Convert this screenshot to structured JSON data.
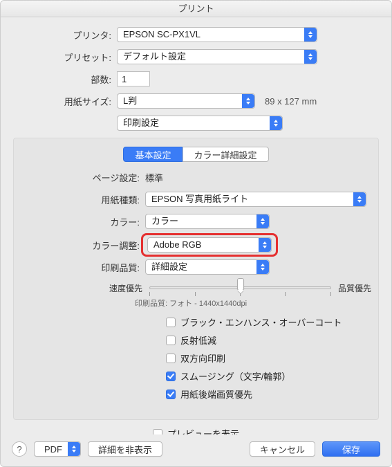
{
  "title": "プリント",
  "printer": {
    "label": "プリンタ:",
    "value": "EPSON SC-PX1VL"
  },
  "preset": {
    "label": "プリセット:",
    "value": "デフォルト設定"
  },
  "copies": {
    "label": "部数:",
    "value": "1"
  },
  "paperSize": {
    "label": "用紙サイズ:",
    "value": "L判",
    "dimensions": "89 x 127 mm"
  },
  "sectionSelect": {
    "value": "印刷設定"
  },
  "tabs": {
    "basic": "基本設定",
    "colorDetail": "カラー詳細設定"
  },
  "inner": {
    "pageSettings": {
      "label": "ページ設定:",
      "value": "標準"
    },
    "mediaType": {
      "label": "用紙種類:",
      "value": "EPSON 写真用紙ライト"
    },
    "color": {
      "label": "カラー:",
      "value": "カラー"
    },
    "colorAdjust": {
      "label": "カラー調整:",
      "value": "Adobe RGB"
    },
    "printQuality": {
      "label": "印刷品質:",
      "value": "詳細設定"
    },
    "slider": {
      "left": "速度優先",
      "right": "品質優先",
      "position_pct": 50,
      "ticks": 5
    },
    "qualityInfo": {
      "label": "印刷品質:",
      "value": "フォト - 1440x1440dpi"
    }
  },
  "checks": [
    {
      "label": "ブラック・エンハンス・オーバーコート",
      "checked": false
    },
    {
      "label": "反射低減",
      "checked": false
    },
    {
      "label": "双方向印刷",
      "checked": false
    },
    {
      "label": "スムージング（文字/輪郭）",
      "checked": true
    },
    {
      "label": "用紙後端画質優先",
      "checked": true
    }
  ],
  "preview": {
    "label": "プレビューを表示",
    "checked": false
  },
  "footer": {
    "help": "?",
    "pdf": "PDF",
    "hideDetails": "詳細を非表示",
    "cancel": "キャンセル",
    "save": "保存"
  }
}
